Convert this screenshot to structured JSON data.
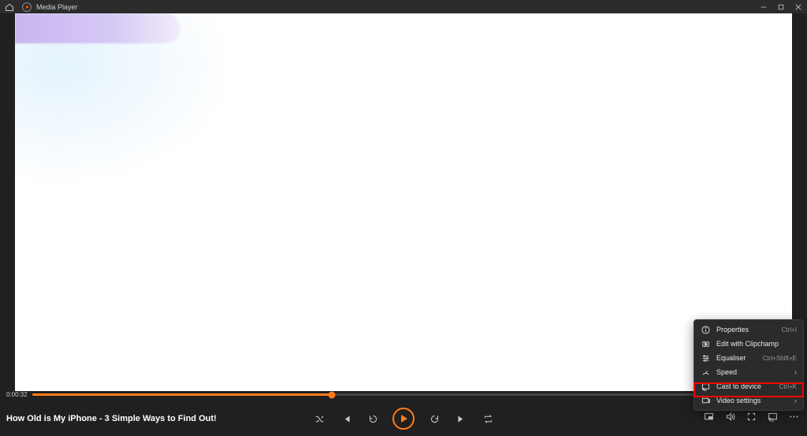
{
  "titlebar": {
    "app_name": "Media Player"
  },
  "playback": {
    "title": "How Old is My iPhone - 3 Simple Ways to Find Out!",
    "current_time": "0:00:32",
    "percent": 39
  },
  "menu": {
    "items": [
      {
        "label": "Properties",
        "shortcut": "Ctrl+I"
      },
      {
        "label": "Edit with Clipchamp",
        "shortcut": ""
      },
      {
        "label": "Equaliser",
        "shortcut": "Ctrl+Shift+E"
      },
      {
        "label": "Speed",
        "submenu": true
      },
      {
        "label": "Cast to device",
        "shortcut": "Ctrl+K"
      },
      {
        "label": "Video settings",
        "submenu": true
      }
    ]
  }
}
